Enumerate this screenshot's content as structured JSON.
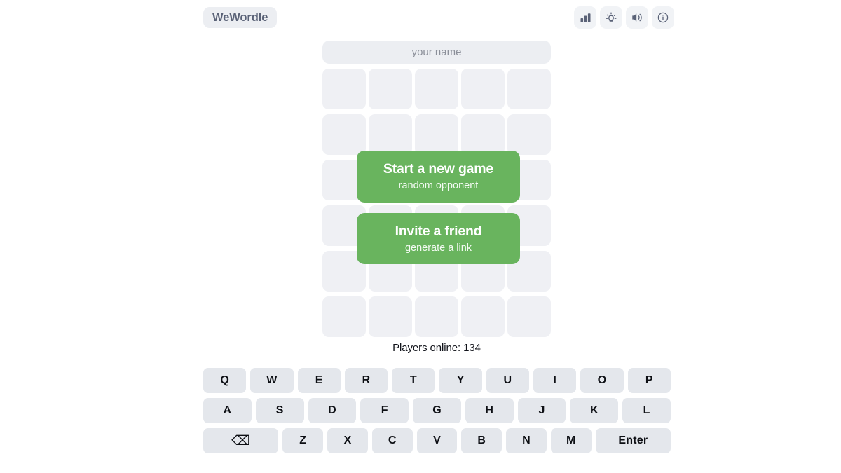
{
  "app": {
    "logo": "WeWordle",
    "background": "#ffffff",
    "accent_green": "#69b45e",
    "tile_color": "#eff0f4",
    "key_color": "#e4e7ec"
  },
  "header": {
    "icons": [
      {
        "name": "stats-icon",
        "label": "statistics"
      },
      {
        "name": "lightbulb-icon",
        "label": "hint"
      },
      {
        "name": "sound-icon",
        "label": "sound"
      },
      {
        "name": "info-icon",
        "label": "info"
      }
    ]
  },
  "name_field": {
    "placeholder": "your name",
    "value": ""
  },
  "board": {
    "rows": 6,
    "columns": 5,
    "cells": [
      [
        "",
        "",
        "",
        "",
        ""
      ],
      [
        "",
        "",
        "",
        "",
        ""
      ],
      [
        "",
        "",
        "",
        "",
        ""
      ],
      [
        "",
        "",
        "",
        "",
        ""
      ],
      [
        "",
        "",
        "",
        "",
        ""
      ],
      [
        "",
        "",
        "",
        "",
        ""
      ]
    ]
  },
  "cta": {
    "start": {
      "title": "Start a new game",
      "subtitle": "random opponent"
    },
    "invite": {
      "title": "Invite a friend",
      "subtitle": "generate a link"
    }
  },
  "status": {
    "players_online": "Players online: 134"
  },
  "keyboard": {
    "row1": [
      "Q",
      "W",
      "E",
      "R",
      "T",
      "Y",
      "U",
      "I",
      "O",
      "P"
    ],
    "row2": [
      "A",
      "S",
      "D",
      "F",
      "G",
      "H",
      "J",
      "K",
      "L"
    ],
    "row3_backspace": "⌫",
    "row3": [
      "Z",
      "X",
      "C",
      "V",
      "B",
      "N",
      "M"
    ],
    "row3_enter": "Enter"
  }
}
